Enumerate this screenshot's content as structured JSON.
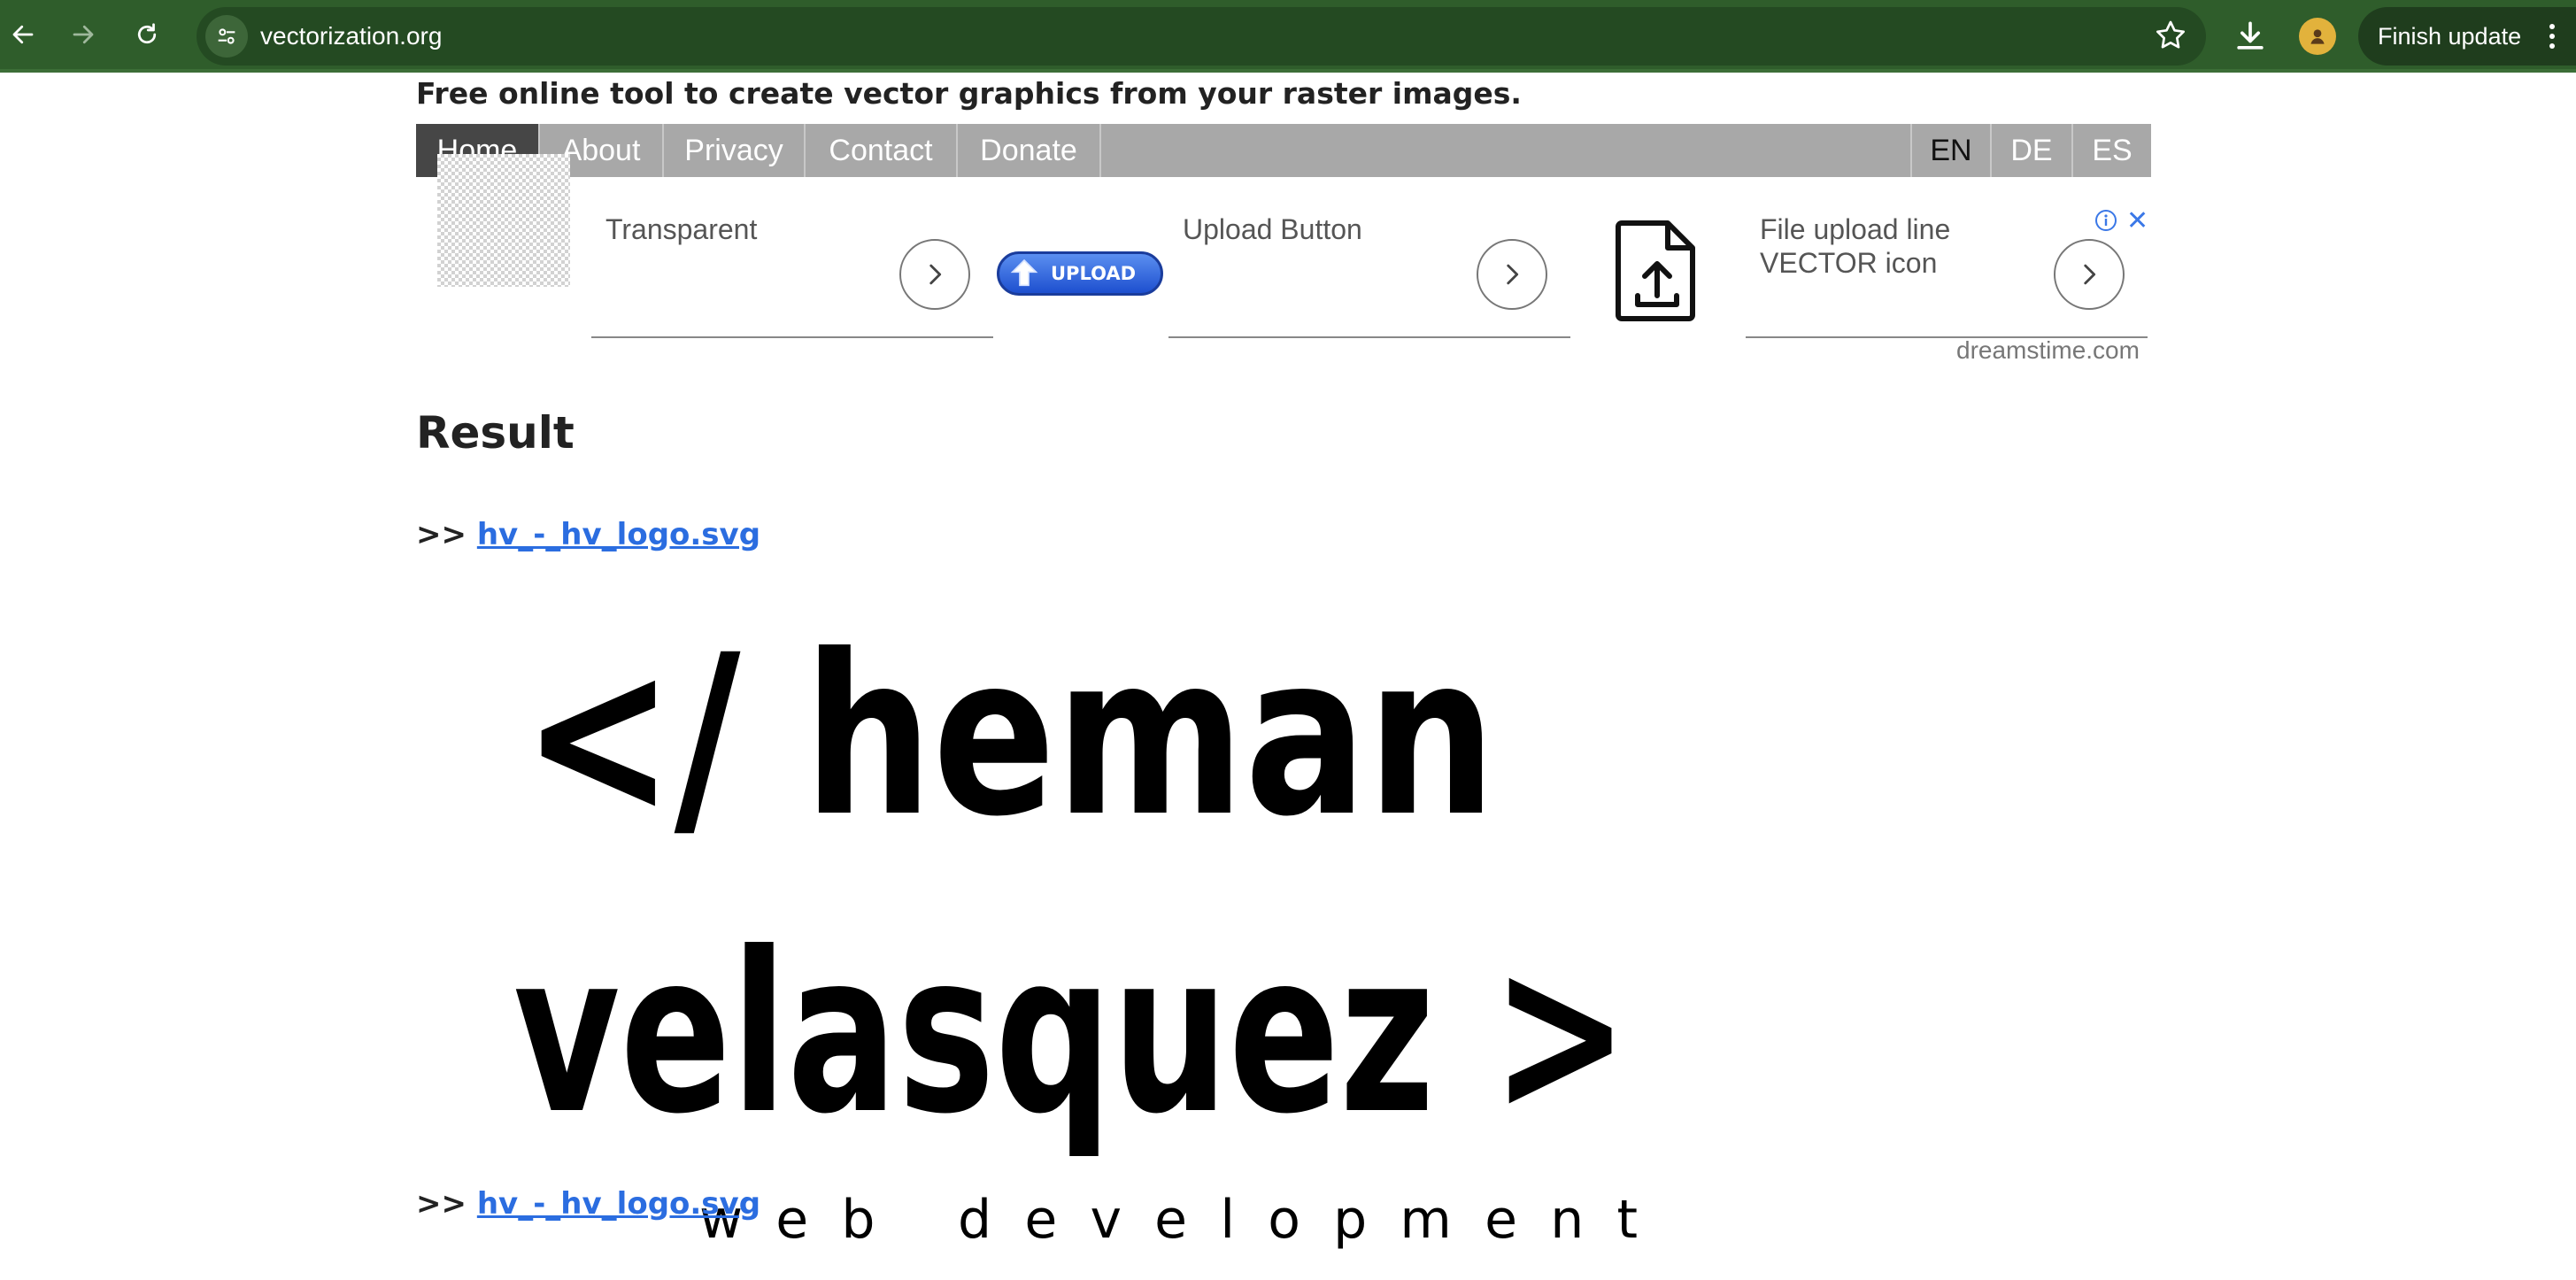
{
  "browser": {
    "url": "vectorization.org",
    "finish_update_label": "Finish update"
  },
  "page": {
    "tagline": "Free online tool to create vector graphics from your raster images.",
    "menu": [
      "Home",
      "About",
      "Privacy",
      "Contact",
      "Donate"
    ],
    "languages": [
      "EN",
      "DE",
      "ES"
    ],
    "active_menu": "Home",
    "active_language": "EN"
  },
  "ads": {
    "items": [
      {
        "label": "Transparent"
      },
      {
        "label": "Upload Button",
        "badge_text": "UPLOAD"
      },
      {
        "label_line1": "File upload line",
        "label_line2": "VECTOR icon"
      }
    ],
    "source": "dreamstime.com"
  },
  "result": {
    "heading": "Result",
    "prefix": ">>",
    "filename": "hv_-_hv_logo.svg",
    "logo_line1": "</ heman",
    "logo_line2": "velasquez >",
    "logo_line3": "web development"
  },
  "colors": {
    "chrome": "#2f5d2b",
    "menu_bg": "#a8a8a8",
    "menu_active": "#464646",
    "link": "#2b6de0"
  }
}
